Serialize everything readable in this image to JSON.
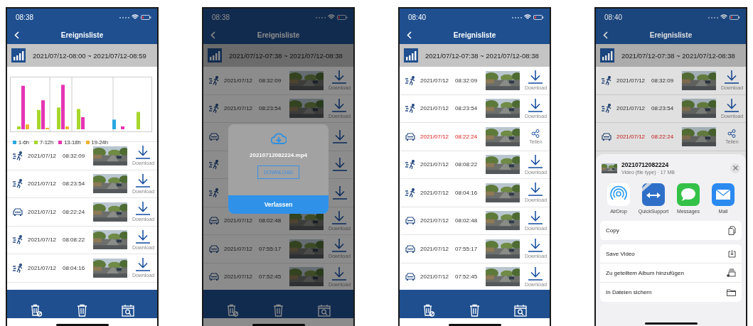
{
  "phones": [
    {
      "status_time": "08:38",
      "title": "Ereignisliste",
      "range": "2021/07/12-08:00 ~ 2021/07/12-08:59",
      "chart": {
        "legend": [
          {
            "label": "1-6h",
            "color": "#2aa7e0"
          },
          {
            "label": "7-12h",
            "color": "#a8d62c"
          },
          {
            "label": "13-18h",
            "color": "#e535b4"
          },
          {
            "label": "19-24h",
            "color": "#f0b232"
          }
        ]
      },
      "rows": [
        {
          "kind": "motion",
          "date": "2021/07/12",
          "time": "08:32:09",
          "highlighted": false,
          "action": {
            "kind": "download",
            "label": "Download"
          }
        },
        {
          "kind": "motion",
          "date": "2021/07/12",
          "time": "08:23:54",
          "highlighted": false,
          "action": {
            "kind": "download",
            "label": "Download"
          }
        },
        {
          "kind": "car",
          "date": "2021/07/12",
          "time": "08:22:24",
          "highlighted": false,
          "action": {
            "kind": "download",
            "label": "Download"
          }
        },
        {
          "kind": "motion",
          "date": "2021/07/12",
          "time": "08:08:22",
          "highlighted": false,
          "action": {
            "kind": "download",
            "label": "Download"
          }
        },
        {
          "kind": "motion",
          "date": "2021/07/12",
          "time": "08:04:16",
          "highlighted": false,
          "action": {
            "kind": "download",
            "label": "Download"
          }
        }
      ]
    },
    {
      "status_time": "08:38",
      "title": "Ereignisliste",
      "range": "2021/07/12-07:38 ~ 2021/07/12-08:38",
      "rows": [
        {
          "kind": "motion",
          "date": "2021/07/12",
          "time": "08:32:09",
          "highlighted": false,
          "action": {
            "kind": "download",
            "label": "Download"
          }
        },
        {
          "kind": "motion",
          "date": "2021/07/12",
          "time": "08:23:54",
          "highlighted": false,
          "action": {
            "kind": "download",
            "label": "Download"
          }
        },
        {
          "kind": "car",
          "action": {
            "kind": "download"
          }
        },
        {
          "kind": "motion",
          "action": {
            "kind": "download"
          }
        },
        {
          "kind": "motion",
          "action": {
            "kind": "download"
          }
        },
        {
          "kind": "car",
          "date": "2021/07/12",
          "time": "08:02:48",
          "highlighted": false,
          "action": {
            "kind": "download",
            "label": "Download"
          }
        },
        {
          "kind": "car",
          "date": "2021/07/12",
          "time": "07:55:17",
          "highlighted": false,
          "action": {
            "kind": "download",
            "label": "Download"
          }
        },
        {
          "kind": "car",
          "date": "2021/07/12",
          "time": "07:52:45",
          "highlighted": false,
          "action": {
            "kind": "download",
            "label": "Download"
          }
        }
      ],
      "dialog": {
        "file_name": "20210712082224.mp4",
        "download_label": "DOWNLOAD",
        "exit_label": "Verlassen"
      }
    },
    {
      "status_time": "08:40",
      "title": "Ereignisliste",
      "range": "2021/07/12-07:38 ~ 2021/07/12-08:38",
      "rows": [
        {
          "kind": "motion",
          "date": "2021/07/12",
          "time": "08:32:09",
          "highlighted": false,
          "action": {
            "kind": "download",
            "label": "Download"
          }
        },
        {
          "kind": "motion",
          "date": "2021/07/12",
          "time": "08:23:54",
          "highlighted": false,
          "action": {
            "kind": "download",
            "label": "Download"
          }
        },
        {
          "kind": "car",
          "date": "2021/07/12",
          "time": "08:22:24",
          "highlighted": true,
          "action": {
            "kind": "share",
            "label": "Teilen"
          }
        },
        {
          "kind": "motion",
          "date": "2021/07/12",
          "time": "08:08:22",
          "highlighted": false,
          "action": {
            "kind": "download",
            "label": "Download"
          }
        },
        {
          "kind": "motion",
          "date": "2021/07/12",
          "time": "08:04:16",
          "highlighted": false,
          "action": {
            "kind": "download",
            "label": "Download"
          }
        },
        {
          "kind": "car",
          "date": "2021/07/12",
          "time": "08:02:48",
          "highlighted": false,
          "action": {
            "kind": "download",
            "label": "Download"
          }
        },
        {
          "kind": "car",
          "date": "2021/07/12",
          "time": "07:55:17",
          "highlighted": false,
          "action": {
            "kind": "download",
            "label": "Download"
          }
        },
        {
          "kind": "car",
          "date": "2021/07/12",
          "time": "07:52:45",
          "highlighted": false,
          "action": {
            "kind": "download",
            "label": "Download"
          }
        }
      ]
    },
    {
      "status_time": "08:40",
      "title": "Ereignisliste",
      "range": "2021/07/12-07:38 ~ 2021/07/12-08:38",
      "rows": [
        {
          "kind": "motion",
          "date": "2021/07/12",
          "time": "08:32:09",
          "highlighted": false,
          "action": {
            "kind": "download",
            "label": "Download"
          }
        },
        {
          "kind": "motion",
          "date": "2021/07/12",
          "time": "08:23:54",
          "highlighted": false,
          "action": {
            "kind": "download",
            "label": "Download"
          }
        },
        {
          "kind": "car",
          "date": "2021/07/12",
          "time": "08:22:24",
          "highlighted": true,
          "action": {
            "kind": "share",
            "label": "Teilen"
          }
        }
      ],
      "share_sheet": {
        "file_name": "20210712082224",
        "file_info": "Video (file type) · 17 MB",
        "apps": [
          {
            "kind": "airdrop",
            "label": "AirDrop"
          },
          {
            "kind": "quicksupport",
            "label": "QuickSupport"
          },
          {
            "kind": "messages",
            "label": "Messages"
          },
          {
            "kind": "mail",
            "label": "Mail"
          }
        ],
        "groups": [
          {
            "actions": [
              {
                "kind": "copy",
                "label": "Copy"
              }
            ]
          },
          {
            "actions": [
              {
                "kind": "save",
                "label": "Save Video"
              },
              {
                "kind": "album",
                "label": "Zu geteiltem Album hinzufügen"
              },
              {
                "kind": "files",
                "label": "In Dateien sichern"
              }
            ]
          }
        ]
      }
    }
  ]
}
